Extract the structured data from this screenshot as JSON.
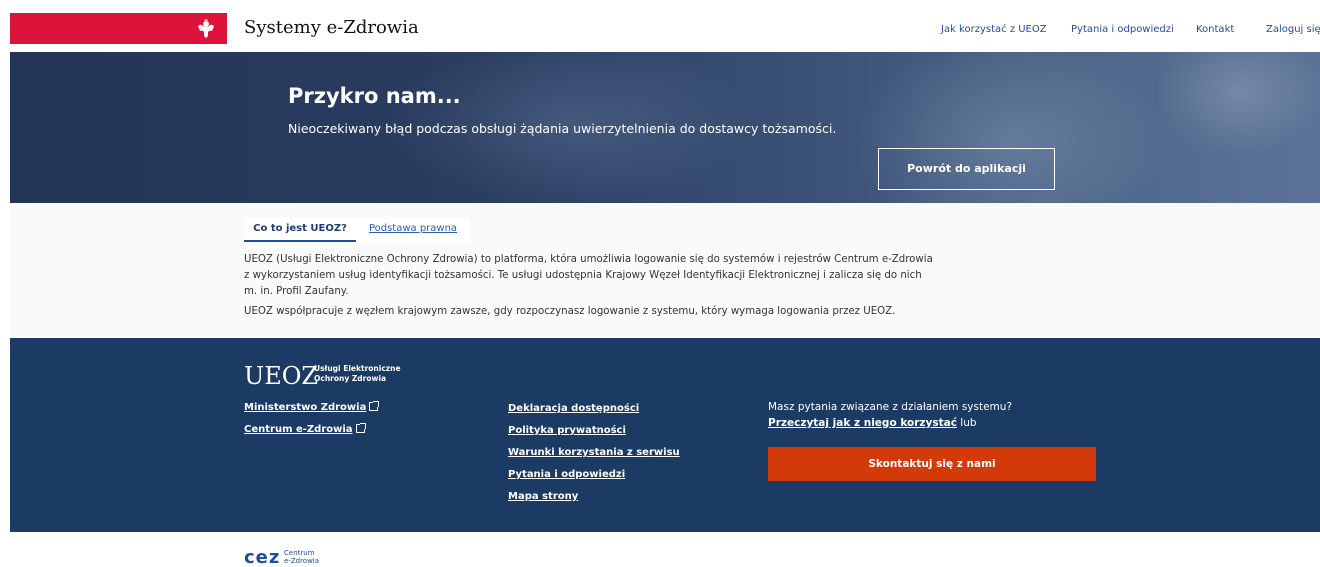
{
  "header": {
    "site_title": "Systemy e-Zdrowia",
    "nav": {
      "how_to": "Jak korzystać z UEOZ",
      "faq": "Pytania i odpowiedzi",
      "contact": "Kontakt",
      "login": "Zaloguj się"
    },
    "flag_color": "#dc143c"
  },
  "hero": {
    "title": "Przykro nam...",
    "message": "Nieoczekiwany błąd podczas obsługi żądania uwierzytelnienia do dostawcy tożsamości.",
    "back_button": "Powrót do aplikacji"
  },
  "info": {
    "tabs": [
      "Co to jest UEOZ?",
      "Podstawa prawna"
    ],
    "paragraph1": "UEOZ (Usługi Elektroniczne Ochrony Zdrowia) to platforma, która umożliwia logowanie się do systemów i rejestrów Centrum e-Zdrowia z wykorzystaniem usług identyfikacji tożsamości. Te usługi udostępnia Krajowy Węzeł Identyfikacji Elektronicznej i zalicza się do nich m. in. Profil Zaufany.",
    "paragraph2": "UEOZ współpracuje z węzłem krajowym zawsze, gdy rozpoczynasz logowanie z systemu, który wymaga logowania przez UEOZ."
  },
  "footer": {
    "logo": "UEOZ",
    "logo_sub1": "Usługi Elektroniczne",
    "logo_sub2": "Ochrony Zdrowia",
    "links_col1": [
      "Ministerstwo Zdrowia",
      "Centrum e-Zdrowia"
    ],
    "links_col2": [
      "Deklaracja dostępności",
      "Polityka prywatności",
      "Warunki korzystania z serwisu",
      "Pytania i odpowiedzi",
      "Mapa strony"
    ],
    "help_question": "Masz pytania związane z działaniem systemu?",
    "help_link": "Przeczytaj jak z niego korzystać",
    "help_suffix": " lub",
    "contact_button": "Skontaktuj się z nami",
    "bg_color": "#1b3a64",
    "accent_color": "#d23a0a"
  },
  "bottom_logo": {
    "mark": "cez",
    "sub1": "Centrum",
    "sub2": "e-Zdrowia"
  }
}
